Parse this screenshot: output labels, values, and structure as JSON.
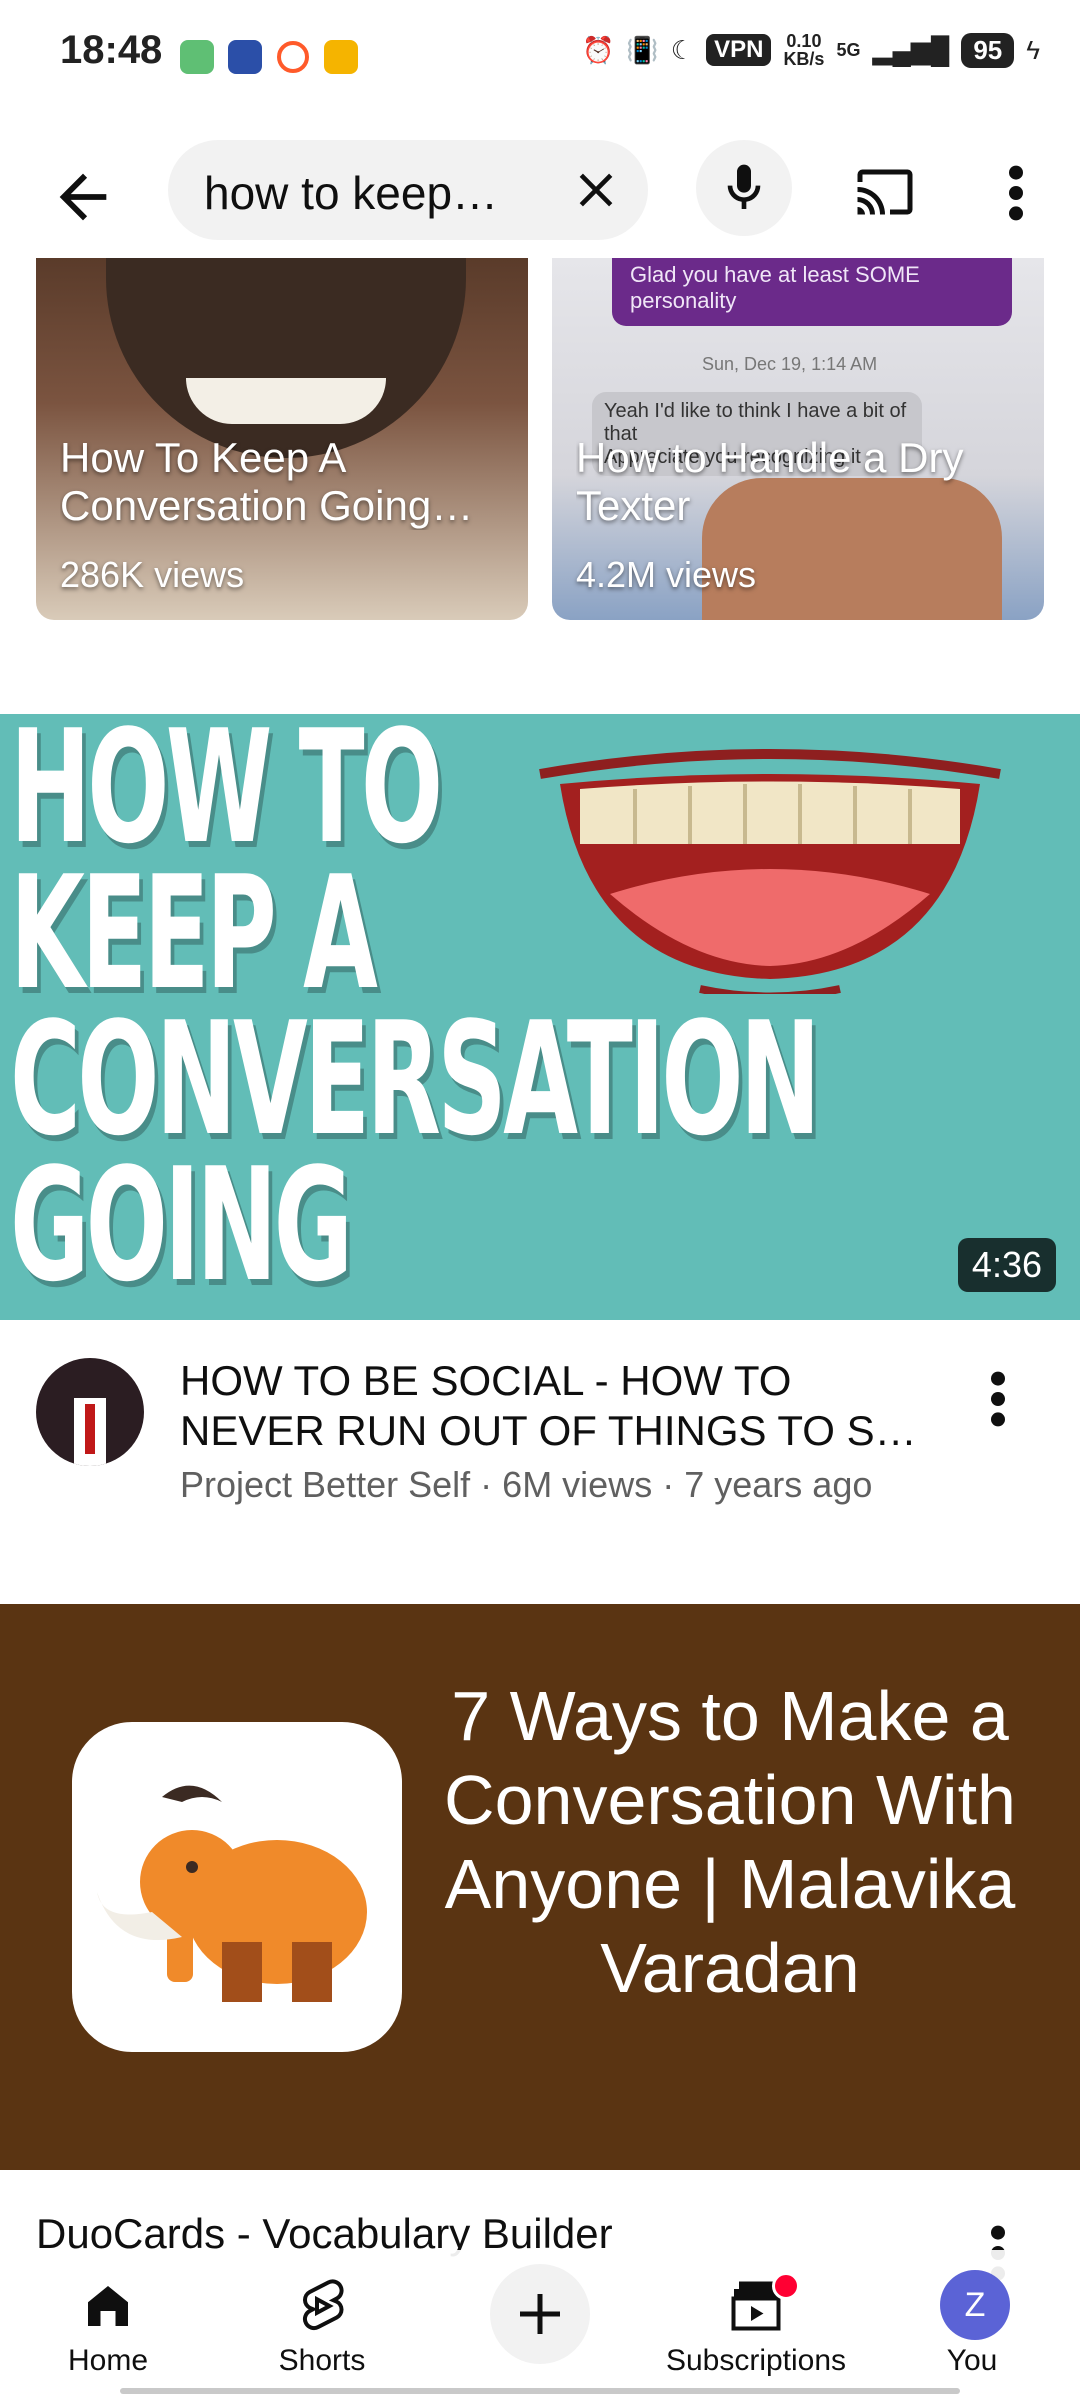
{
  "status_bar": {
    "time": "18:48",
    "vpn": "VPN",
    "net_speed_value": "0.10",
    "net_speed_unit": "KB/s",
    "network": "5G",
    "battery": "95",
    "app_icon_colors": [
      "#5fbf74",
      "#2b4fa8",
      "#ff5a2a",
      "#f5b400"
    ]
  },
  "search": {
    "query": "how to keep…",
    "back_icon": "arrow-left-icon",
    "clear_icon": "close-icon",
    "mic_icon": "microphone-icon",
    "cast_icon": "cast-icon",
    "more_icon": "more-vert-icon"
  },
  "shorts": [
    {
      "title": "How To Keep A Conversation Going…",
      "views": "286K views"
    },
    {
      "title": "How to Handle a Dry Texter",
      "views": "4.2M views",
      "overlay_text": {
        "bubble_top": "Glad you have at least SOME personality",
        "date": "Sun, Dec 19, 1:14 AM",
        "bubble_reply": "Yeah I'd like to think I have a bit of that",
        "bubble_reply_2": "Appreciate you recognizing it"
      }
    }
  ],
  "video": {
    "thumbnail_text": "HOW TO KEEP A CONVERSATION GOING",
    "duration": "4:36",
    "title": "HOW TO BE SOCIAL - HOW TO NEVER RUN OUT OF THINGS TO S…",
    "channel": "Project Better Self",
    "views": "6M views",
    "age": "7 years ago",
    "separator": "·",
    "thumb_bg": "#62bdb7"
  },
  "ad": {
    "headline": "7 Ways to Make a Conversation With Anyone | Malavika Varadan",
    "title": "DuoCards - Vocabulary Builder",
    "banner_bg": "#5a3412"
  },
  "nav": {
    "home": "Home",
    "shorts": "Shorts",
    "subscriptions": "Subscriptions",
    "you": "You",
    "avatar_initial": "Z"
  }
}
